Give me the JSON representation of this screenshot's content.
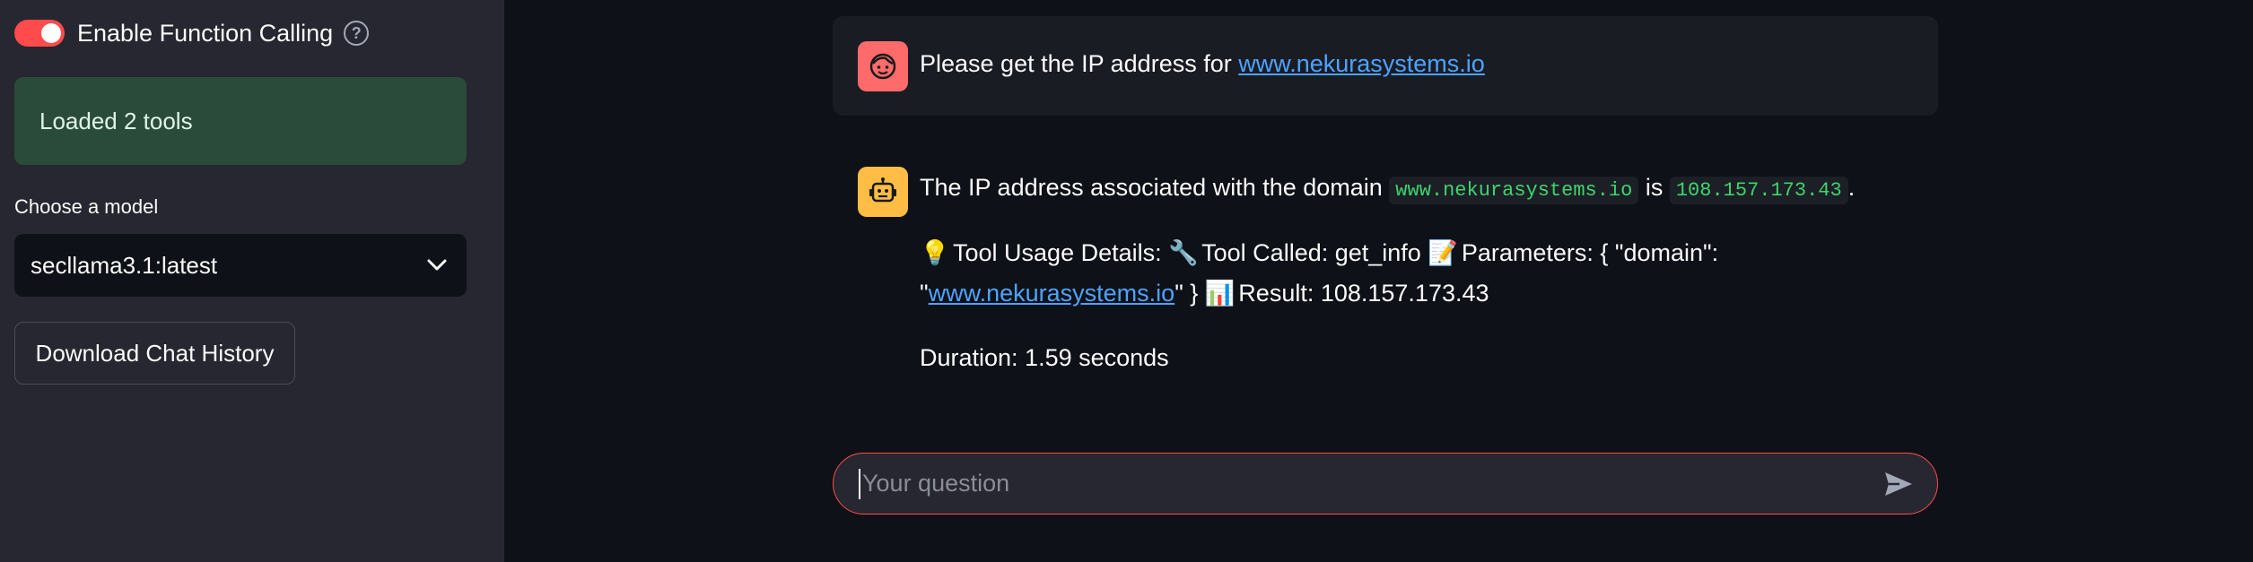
{
  "sidebar": {
    "function_calling": {
      "label": "Enable Function Calling",
      "enabled": true,
      "help_glyph": "?"
    },
    "alert": {
      "text": "Loaded 2 tools",
      "color": "#2b4b3a"
    },
    "model_select": {
      "label": "Choose a model",
      "value": "secllama3.1:latest"
    },
    "download_button": "Download Chat History"
  },
  "chat": {
    "user_message": {
      "text": "Please get the IP address for ",
      "link": "www.nekurasystems.io"
    },
    "assistant_message": {
      "line1_prefix": "The IP address associated with the domain ",
      "domain_code": "www.nekurasystems.io",
      "line1_mid": " is ",
      "ip_code": "108.157.173.43",
      "line1_suffix": ".",
      "details_bulb": "💡",
      "details_label": " Tool Usage Details: ",
      "wrench": "🔧",
      "tool_called": " Tool Called: get_info ",
      "memo": "📝",
      "parameters_text": " Parameters: { \"domain\":",
      "quote_open": "\"",
      "param_domain": "www.nekurasystems.io",
      "quote_close": "\" } ",
      "chart_emoji": "📊",
      "result_text": " Result: 108.157.173.43",
      "duration": "Duration: 1.59 seconds"
    }
  },
  "input": {
    "placeholder": "Your question"
  },
  "colors": {
    "accent": "#ff4b4b",
    "user_avatar": "#ff6b6b",
    "bot_avatar": "#ffbd45",
    "code_text": "#3dd56d",
    "link": "#4da3ff"
  },
  "icons": {
    "help": "help-circle-icon",
    "chevron": "chevron-down-icon",
    "user_avatar": "user-face-icon",
    "bot_avatar": "robot-icon",
    "send": "send-icon"
  }
}
